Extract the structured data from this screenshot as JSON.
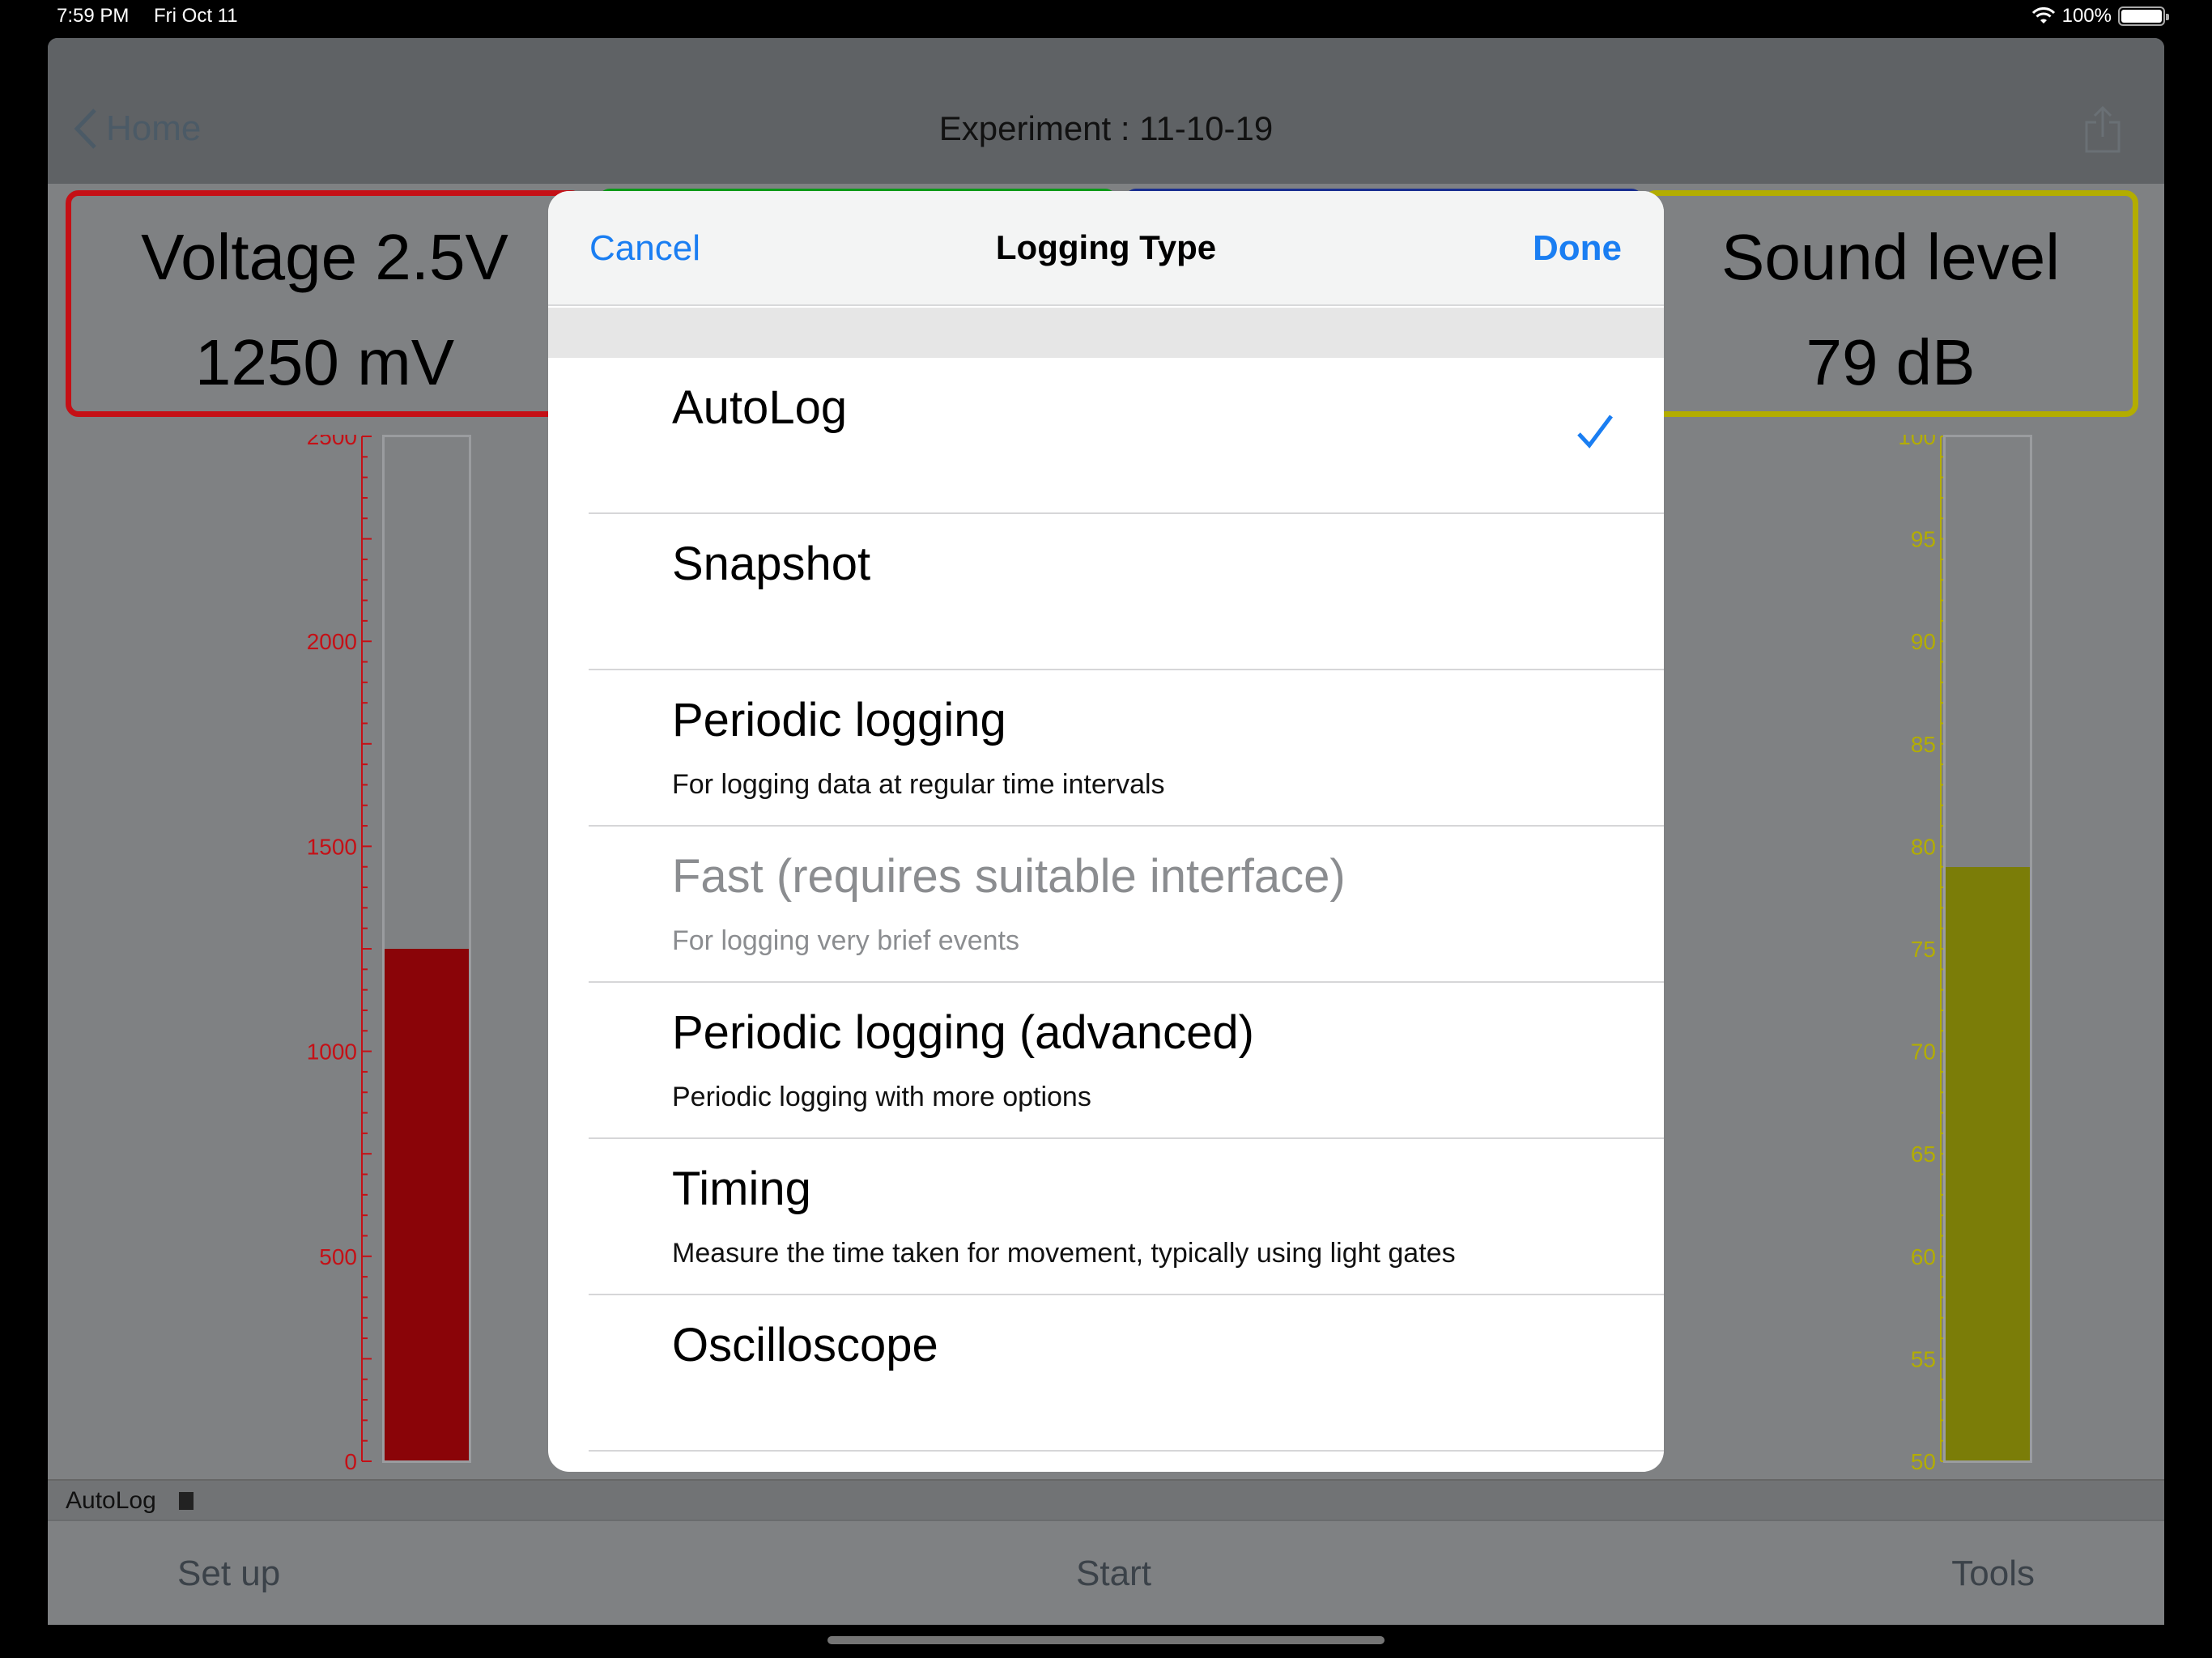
{
  "status_bar": {
    "time": "7:59 PM",
    "date": "Fri Oct 11",
    "battery": "100%"
  },
  "nav": {
    "back_label": "Home",
    "title": "Experiment : 11-10-19"
  },
  "meters": {
    "voltage": {
      "line1": "Voltage 2.5V",
      "line2": "1250 mV",
      "color": "#c51016"
    },
    "sound": {
      "line1": "Sound level",
      "line2": "79 dB",
      "color": "#b3ad00"
    }
  },
  "gauges": {
    "voltage": {
      "min": 0,
      "max": 2500,
      "value": 1250,
      "tick_labels": [
        "2500",
        "2000",
        "1500",
        "1000",
        "500",
        "0"
      ],
      "fill_color": "#8a0408",
      "tick_color": "#c51016"
    },
    "sound": {
      "min": 50,
      "max": 100,
      "value": 79,
      "tick_labels": [
        "100",
        "95",
        "90",
        "85",
        "80",
        "75",
        "70",
        "65",
        "60",
        "55",
        "50"
      ],
      "fill_color": "#7b7d08",
      "tick_color": "#b3ad00"
    }
  },
  "bottom_status": {
    "mode": "AutoLog"
  },
  "toolbar": {
    "setup": "Set up",
    "start": "Start",
    "tools": "Tools"
  },
  "modal": {
    "cancel": "Cancel",
    "title": "Logging Type",
    "done": "Done",
    "options": [
      {
        "title": "AutoLog",
        "subtitle": "",
        "selected": true,
        "disabled": false
      },
      {
        "title": "Snapshot",
        "subtitle": "",
        "selected": false,
        "disabled": false
      },
      {
        "title": "Periodic logging",
        "subtitle": "For logging data at regular time intervals",
        "selected": false,
        "disabled": false
      },
      {
        "title": "Fast (requires suitable interface)",
        "subtitle": "For logging very brief events",
        "selected": false,
        "disabled": true
      },
      {
        "title": "Periodic logging (advanced)",
        "subtitle": "Periodic logging with more options",
        "selected": false,
        "disabled": false
      },
      {
        "title": "Timing",
        "subtitle": "Measure the time taken for movement, typically using light gates",
        "selected": false,
        "disabled": false
      },
      {
        "title": "Oscilloscope",
        "subtitle": "",
        "selected": false,
        "disabled": false
      }
    ]
  }
}
